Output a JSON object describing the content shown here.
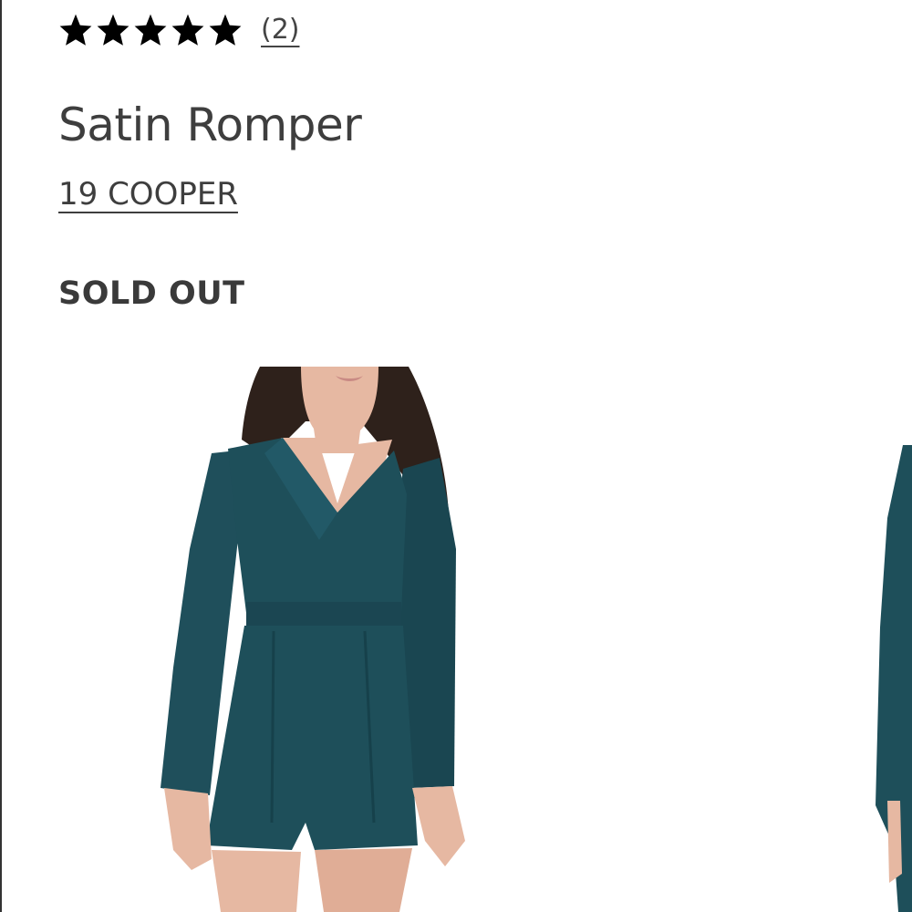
{
  "product": {
    "rating_stars": 5,
    "review_count": "(2)",
    "title": "Satin Romper",
    "brand": "19 COOPER",
    "availability": "SOLD OUT"
  },
  "gallery": {
    "main_image": "romper-front-photo",
    "next_image": "romper-side-photo"
  },
  "colors": {
    "garment": "#1e4f5a",
    "text": "#3a3a3a",
    "star": "#000000"
  }
}
